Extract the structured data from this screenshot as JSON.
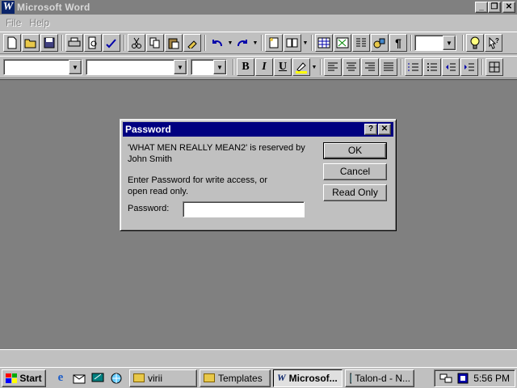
{
  "window": {
    "title": "Microsoft Word",
    "icon_letter": "W",
    "minimize": "_",
    "restore": "❐",
    "close": "✕"
  },
  "menu": {
    "items": [
      {
        "label": "File"
      },
      {
        "label": "Help"
      }
    ]
  },
  "toolbar_standard": {
    "icons": [
      "new-document-icon",
      "open-folder-icon",
      "save-icon",
      "print-icon",
      "print-preview-icon",
      "spelling-icon",
      "cut-icon",
      "copy-icon",
      "paste-icon",
      "format-painter-icon",
      "undo-icon",
      "redo-icon",
      "autotext-icon",
      "insert-address-icon",
      "insert-table-icon",
      "insert-excel-icon",
      "columns-icon",
      "drawing-icon",
      "show-paragraph-icon",
      "zoom-combo",
      "tip-wizard-icon",
      "help-icon"
    ]
  },
  "toolbar_formatting": {
    "bold": "B",
    "italic": "I",
    "underline": "U"
  },
  "dialog": {
    "title": "Password",
    "help": "?",
    "close": "✕",
    "message_line1": "'WHAT MEN REALLY MEAN2' is reserved by",
    "message_line2": "John Smith",
    "prompt_line1": "Enter Password for write access, or",
    "prompt_line2": "open read only.",
    "password_label": "Password:",
    "password_value": "",
    "ok": "OK",
    "cancel": "Cancel",
    "read_only": "Read Only"
  },
  "taskbar": {
    "start": "Start",
    "tasks": [
      {
        "label": "virii"
      },
      {
        "label": "Templates"
      },
      {
        "label": "Microsof..."
      },
      {
        "label": "Talon-d - N..."
      }
    ],
    "clock": "5:56 PM"
  },
  "colors": {
    "titlebar_inactive": "#808080",
    "dialog_title": "#000080",
    "workspace": "#808080",
    "face": "#c0c0c0"
  }
}
